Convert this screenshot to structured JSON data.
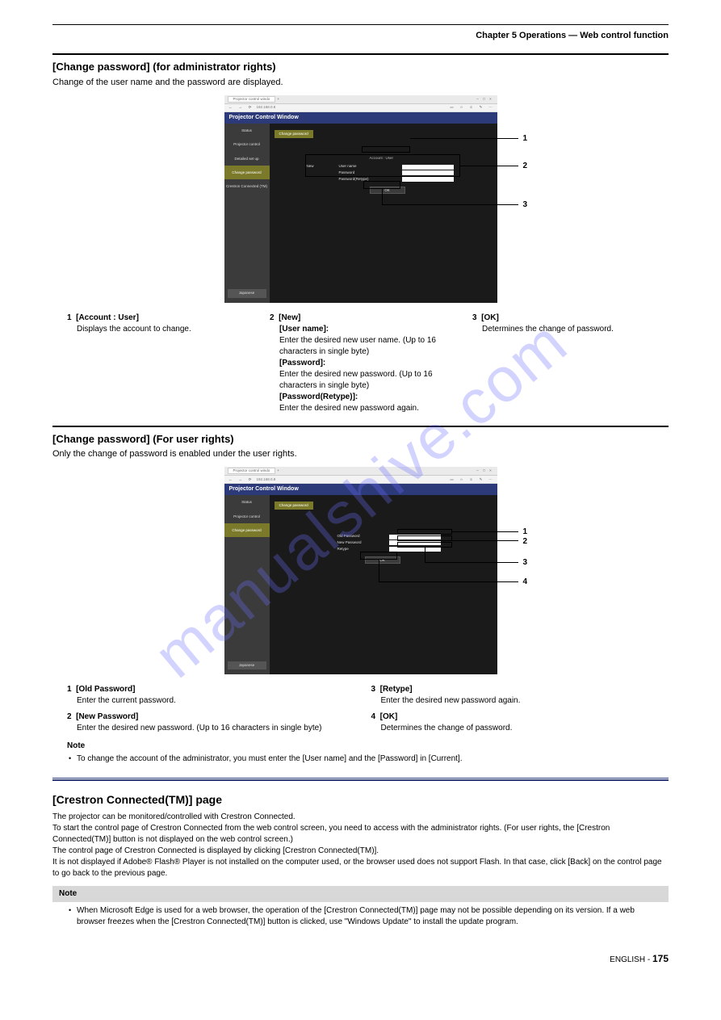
{
  "chapter": "Chapter 5   Operations — Web control function",
  "watermark": "manualshive.com",
  "section1": {
    "title": "[Change password] (for administrator rights)",
    "sub": "Change of the user name and the password are displayed."
  },
  "shot1": {
    "tab": "Projector control windo",
    "url": "192.168.0.8",
    "pcw_title": "Projector Control Window",
    "side": [
      "Status",
      "Projector control",
      "Detailed set up",
      "Change password",
      "Crestron Connected (TM)"
    ],
    "side_jp": "Japanese",
    "chg_btn": "Change password",
    "account": "Account : User",
    "new": "New",
    "labels": [
      "User name",
      "Password",
      "Password(Retype)"
    ],
    "ok": "OK"
  },
  "callouts1": {
    "c1": "1",
    "c2": "2",
    "c3": "3"
  },
  "exp1": {
    "left": {
      "num": "1",
      "title": "[Account : User]",
      "body": "Displays the account to change."
    },
    "mid": {
      "num": "2",
      "title": "[New]",
      "un_lab": "[User name]:",
      "un_txt": "Enter the desired new user name. (Up to 16 characters in single byte)",
      "pw_lab": "[Password]:",
      "pw_txt": "Enter the desired new password. (Up to 16 characters in single byte)",
      "pr_lab": "[Password(Retype)]:",
      "pr_txt": "Enter the desired new password again."
    },
    "right": {
      "num": "3",
      "title": "[OK]",
      "body": "Determines the change of password."
    }
  },
  "section2": {
    "title": "[Change password] (For user rights)",
    "sub": "Only the change of password is enabled under the user rights."
  },
  "shot2": {
    "tab": "Projector control windo",
    "url": "192.168.0.8",
    "pcw_title": "Projector Control Window",
    "side": [
      "Status",
      "Projector control",
      "Change password"
    ],
    "side_jp": "Japanese",
    "chg_btn": "Change password",
    "labels": [
      "Old Password",
      "New Password",
      "Retype"
    ],
    "ok": "OK"
  },
  "callouts2": {
    "c1": "1",
    "c2": "2",
    "c3": "3",
    "c4": "4"
  },
  "exp2": {
    "left1": {
      "num": "1",
      "title": "[Old Password]",
      "body": "Enter the current password."
    },
    "left2": {
      "num": "2",
      "title": "[New Password]",
      "body": "Enter the desired new password. (Up to 16 characters in single byte)"
    },
    "right1": {
      "num": "3",
      "title": "[Retype]",
      "body": "Enter the desired new password again."
    },
    "right2": {
      "num": "4",
      "title": "[OK]",
      "body": "Determines the change of password."
    }
  },
  "note1": {
    "label": "Note",
    "items": [
      "To change the account of the administrator, you must enter the [User name] and the [Password] in [Current]."
    ]
  },
  "crestron": {
    "title": "[Crestron Connected(TM)] page",
    "desc": "The projector can be monitored/controlled with Crestron Connected.\nTo start the control page of Crestron Connected from the web control screen, you need to access with the administrator rights. (For user rights, the [Crestron Connected(TM)] button is not displayed on the web control screen.)\nThe control page of Crestron Connected is displayed by clicking [Crestron Connected(TM)].\nIt is not displayed if Adobe® Flash® Player is not installed on the computer used, or the browser used does not support Flash. In that case, click [Back] on the control page to go back to the previous page."
  },
  "note2": {
    "label": "Note",
    "items": [
      "When Microsoft Edge is used for a web browser, the operation of the [Crestron Connected(TM)] page may not be possible depending on its version. If a web browser freezes when the [Crestron Connected(TM)] button is clicked, use \"Windows Update\" to install the update program."
    ]
  },
  "footer": {
    "text": "ENGLISH - ",
    "page": "175"
  }
}
